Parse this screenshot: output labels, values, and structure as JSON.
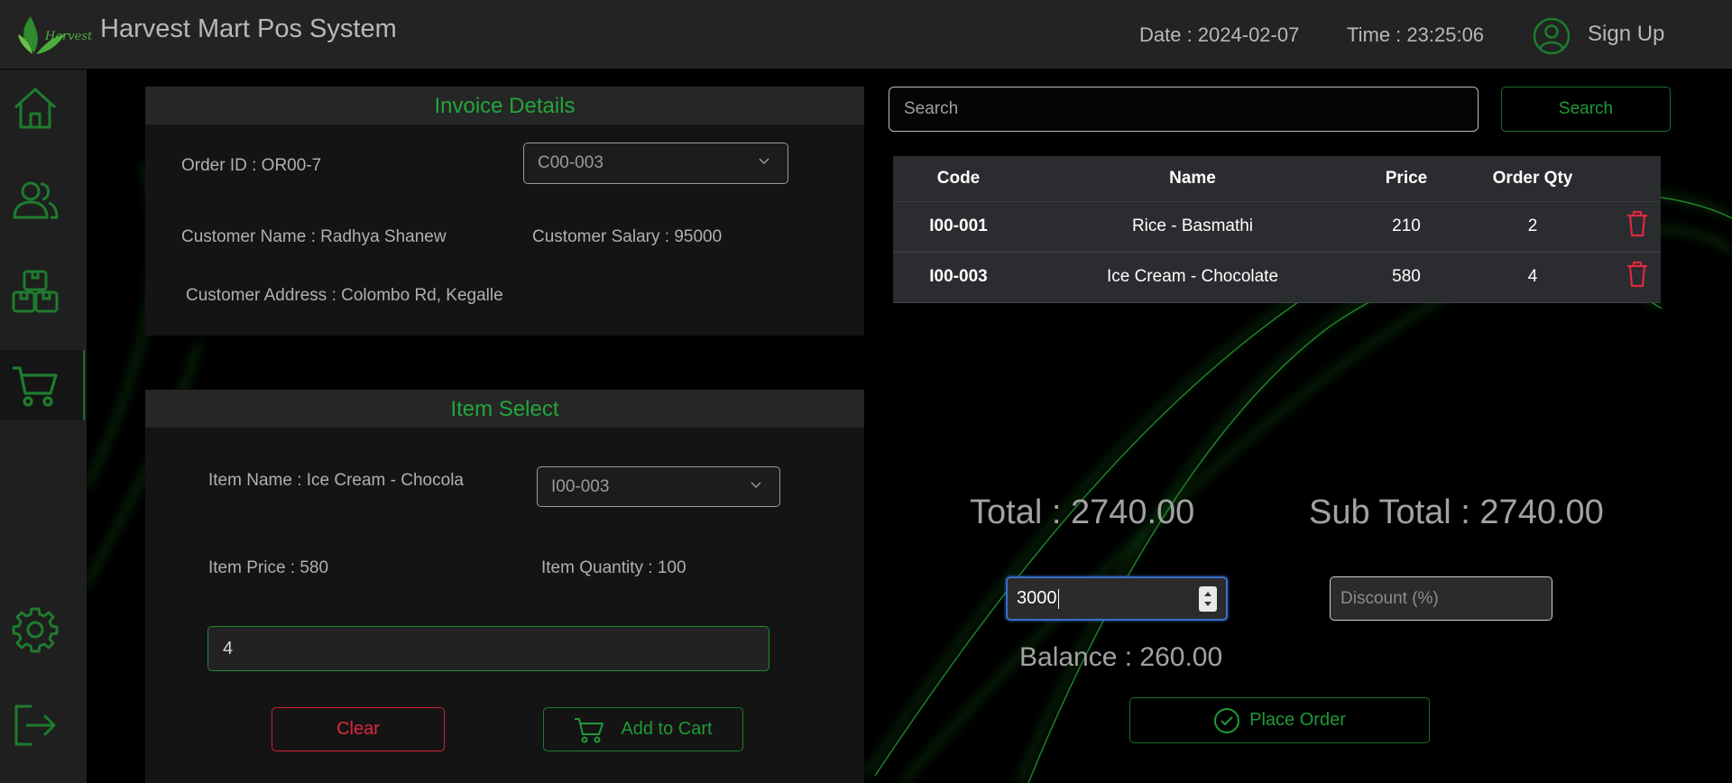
{
  "header": {
    "title": "Harvest Mart Pos System",
    "logo_text": "Harvest",
    "date": "Date : 2024-02-07",
    "time": "Time : 23:25:06",
    "sign_up": "Sign Up"
  },
  "sidebar": {
    "items": [
      {
        "icon": "home-icon",
        "active": false
      },
      {
        "icon": "users-icon",
        "active": false
      },
      {
        "icon": "boxes-icon",
        "active": false
      },
      {
        "icon": "cart-icon",
        "active": true
      },
      {
        "icon": "gear-icon",
        "active": false
      },
      {
        "icon": "logout-icon",
        "active": false
      }
    ]
  },
  "invoice": {
    "heading": "Invoice Details",
    "order_id": "Order ID : OR00-7",
    "customer_select": "C00-003",
    "customer_name": "Customer Name : Radhya Shanew",
    "customer_salary": "Customer Salary : 95000",
    "customer_address": "Customer Address : Colombo Rd, Kegalle"
  },
  "item_select": {
    "heading": "Item Select",
    "item_name": "Item Name : Ice Cream - Chocola",
    "item_select": "I00-003",
    "item_price": "Item Price : 580",
    "item_quantity": "Item Quantity : 100",
    "qty_value": "4",
    "clear_label": "Clear",
    "add_label": "Add to Cart"
  },
  "search": {
    "placeholder": "Search",
    "button": "Search"
  },
  "cart": {
    "columns": [
      "Code",
      "Name",
      "Price",
      "Order Qty"
    ],
    "rows": [
      {
        "code": "I00-001",
        "name": "Rice - Basmathi",
        "price": "210",
        "qty": "2"
      },
      {
        "code": "I00-003",
        "name": "Ice Cream - Chocolate",
        "price": "580",
        "qty": "4"
      }
    ]
  },
  "summary": {
    "total": "Total : 2740.00",
    "sub_total": "Sub Total : 2740.00",
    "cash_value": "3000",
    "discount_placeholder": "Discount (%)",
    "balance": "Balance : 260.00",
    "place_order": "Place Order"
  },
  "colors": {
    "accent_green": "#22a63b",
    "danger_red": "#e0283f",
    "header_bg": "#232323",
    "panel_bg": "#141414"
  }
}
